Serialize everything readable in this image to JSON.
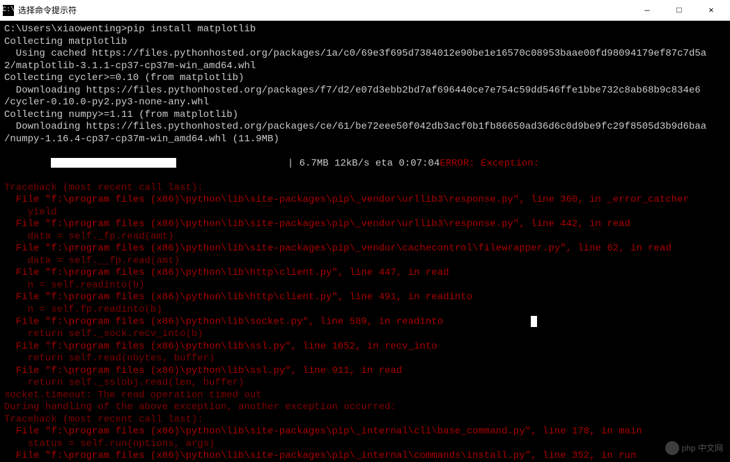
{
  "titlebar": {
    "icon_text": "C:\\",
    "title": "选择命令提示符"
  },
  "window_controls": {
    "minimize": "—",
    "maximize": "□",
    "close": "✕"
  },
  "terminal": {
    "lines": [
      {
        "cls": "white",
        "text": "C:\\Users\\xiaowenting>pip install matplotlib"
      },
      {
        "cls": "white",
        "text": "Collecting matplotlib"
      },
      {
        "cls": "white",
        "text": "  Using cached https://files.pythonhosted.org/packages/1a/c0/69e3f695d7384012e90be1e16570c08953baae00fd98094179ef87c7d5a"
      },
      {
        "cls": "white",
        "text": "2/matplotlib-3.1.1-cp37-cp37m-win_amd64.whl"
      },
      {
        "cls": "white",
        "text": "Collecting cycler>=0.10 (from matplotlib)"
      },
      {
        "cls": "white",
        "text": "  Downloading https://files.pythonhosted.org/packages/f7/d2/e07d3ebb2bd7af696440ce7e754c59dd546ffe1bbe732c8ab68b9c834e6"
      },
      {
        "cls": "white",
        "text": "/cycler-0.10.0-py2.py3-none-any.whl"
      },
      {
        "cls": "white",
        "text": "Collecting numpy>=1.11 (from matplotlib)"
      },
      {
        "cls": "white",
        "text": "  Downloading https://files.pythonhosted.org/packages/ce/61/be72eee50f042db3acf0b1fb86650ad36d6c0d9be9fc29f8505d3b9d6baa"
      },
      {
        "cls": "white",
        "text": "/numpy-1.16.4-cp37-cp37m-win_amd64.whl (11.9MB)"
      }
    ],
    "progress": {
      "filled": 18,
      "text": "| 6.7MB 12kB/s eta 0:07:04",
      "error": "ERROR: Exception:"
    },
    "traceback": [
      {
        "cls": "darkred",
        "text": "Traceback (most recent call last):"
      },
      {
        "cls": "red",
        "text": "  File \"f:\\program files (x86)\\python\\lib\\site-packages\\pip\\_vendor\\urllib3\\response.py\", line 360, in _error_catcher"
      },
      {
        "cls": "darkred",
        "text": "    yield"
      },
      {
        "cls": "red",
        "text": "  File \"f:\\program files (x86)\\python\\lib\\site-packages\\pip\\_vendor\\urllib3\\response.py\", line 442, in read"
      },
      {
        "cls": "darkred",
        "text": "    data = self._fp.read(amt)"
      },
      {
        "cls": "red",
        "text": "  File \"f:\\program files (x86)\\python\\lib\\site-packages\\pip\\_vendor\\cachecontrol\\filewrapper.py\", line 62, in read"
      },
      {
        "cls": "darkred",
        "text": "    data = self.__fp.read(amt)"
      },
      {
        "cls": "red",
        "text": "  File \"f:\\program files (x86)\\python\\lib\\http\\client.py\", line 447, in read"
      },
      {
        "cls": "darkred",
        "text": "    n = self.readinto(b)"
      },
      {
        "cls": "red",
        "text": "  File \"f:\\program files (x86)\\python\\lib\\http\\client.py\", line 491, in readinto"
      },
      {
        "cls": "darkred",
        "text": "    n = self.fp.readinto(b)"
      },
      {
        "cls": "red",
        "text": "  File \"f:\\program files (x86)\\python\\lib\\socket.py\", line 589, in readinto"
      },
      {
        "cls": "darkred",
        "text": "    return self._sock.recv_into(b)"
      },
      {
        "cls": "red",
        "text": "  File \"f:\\program files (x86)\\python\\lib\\ssl.py\", line 1052, in recv_into"
      },
      {
        "cls": "darkred",
        "text": "    return self.read(nbytes, buffer)"
      },
      {
        "cls": "red",
        "text": "  File \"f:\\program files (x86)\\python\\lib\\ssl.py\", line 911, in read"
      },
      {
        "cls": "darkred",
        "text": "    return self._sslobj.read(len, buffer)"
      },
      {
        "cls": "darkred",
        "text": "socket.timeout: The read operation timed out"
      },
      {
        "cls": "darkred",
        "text": ""
      },
      {
        "cls": "darkred",
        "text": "During handling of the above exception, another exception occurred:"
      },
      {
        "cls": "darkred",
        "text": ""
      },
      {
        "cls": "darkred",
        "text": "Traceback (most recent call last):"
      },
      {
        "cls": "red",
        "text": "  File \"f:\\program files (x86)\\python\\lib\\site-packages\\pip\\_internal\\cli\\base_command.py\", line 178, in main"
      },
      {
        "cls": "darkred",
        "text": "    status = self.run(options, args)"
      },
      {
        "cls": "red",
        "text": "  File \"f:\\program files (x86)\\python\\lib\\site-packages\\pip\\_internal\\commands\\install.py\", line 352, in run"
      }
    ],
    "cursor_at_line": 11
  },
  "watermark": {
    "text": "php 中文网"
  }
}
